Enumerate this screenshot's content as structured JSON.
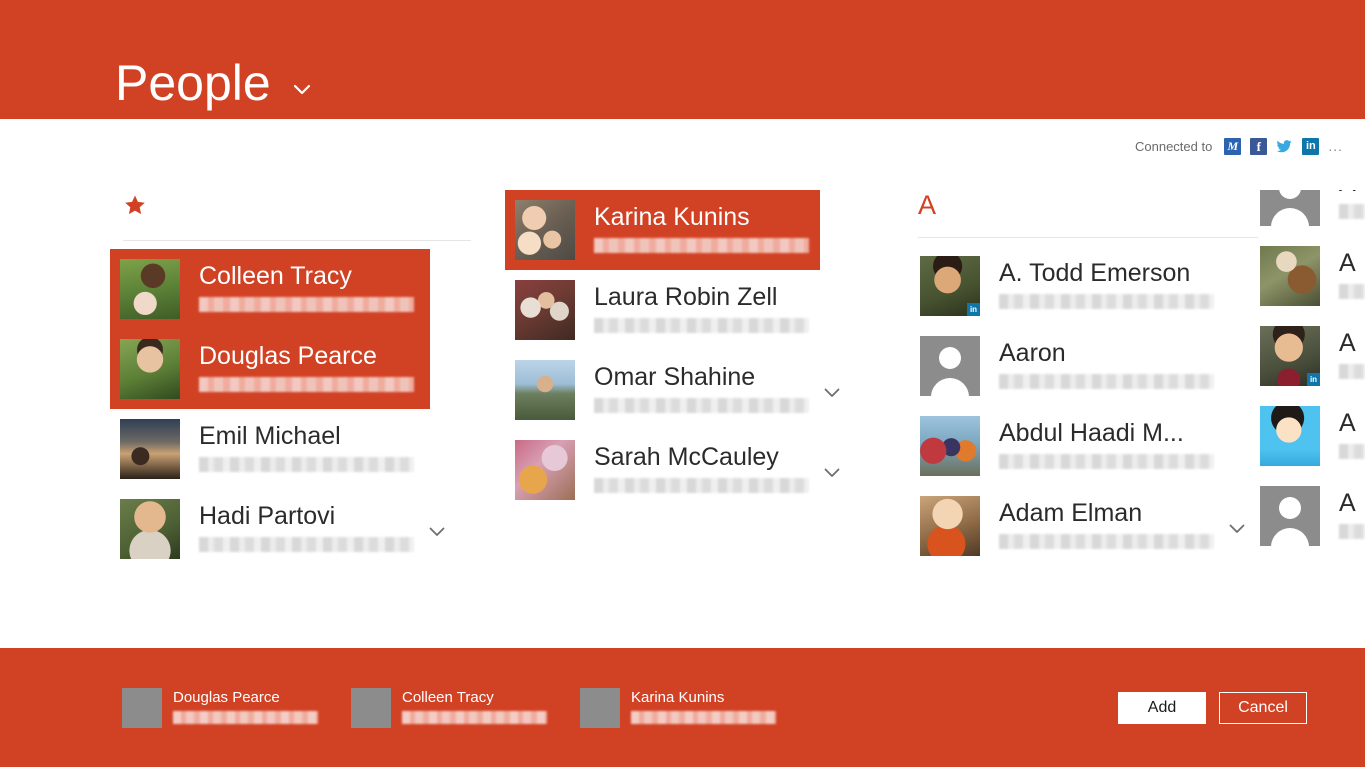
{
  "header": {
    "title": "People",
    "dropdown_icon": "chevron-down-icon"
  },
  "connected": {
    "label": "Connected to",
    "services": [
      {
        "name": "microsoft-icon",
        "glyph": "M"
      },
      {
        "name": "facebook-icon",
        "glyph": "f"
      },
      {
        "name": "twitter-icon",
        "glyph": ""
      },
      {
        "name": "linkedin-icon",
        "glyph": "in"
      }
    ],
    "more": "..."
  },
  "columns": [
    {
      "group_header": "★",
      "group_type": "star",
      "contacts": [
        {
          "name": "Colleen Tracy",
          "selected": true,
          "avatar": "photo",
          "chevron": false,
          "check": true
        },
        {
          "name": "Douglas Pearce",
          "selected": true,
          "avatar": "photo",
          "chevron": true,
          "check": true
        },
        {
          "name": "Emil Michael",
          "selected": false,
          "avatar": "photo",
          "chevron": false,
          "check": false
        },
        {
          "name": "Hadi Partovi",
          "selected": false,
          "avatar": "photo",
          "chevron": true,
          "check": false
        }
      ]
    },
    {
      "group_header": "",
      "group_type": "none",
      "contacts": [
        {
          "name": "Karina Kunins",
          "selected": true,
          "avatar": "photo",
          "chevron": false,
          "check": true
        },
        {
          "name": "Laura Robin Zell",
          "selected": false,
          "avatar": "photo",
          "chevron": false,
          "check": false
        },
        {
          "name": "Omar Shahine",
          "selected": false,
          "avatar": "photo",
          "chevron": true,
          "check": false
        },
        {
          "name": "Sarah McCauley",
          "selected": false,
          "avatar": "photo",
          "chevron": true,
          "check": false
        }
      ]
    },
    {
      "group_header": "A",
      "group_type": "letter",
      "contacts": [
        {
          "name": "A. Todd Emerson",
          "selected": false,
          "avatar": "photo",
          "badge": "linkedin",
          "chevron": false,
          "check": false
        },
        {
          "name": "Aaron",
          "selected": false,
          "avatar": "placeholder",
          "chevron": false,
          "check": false
        },
        {
          "name": "Abdul Haadi M...",
          "selected": false,
          "avatar": "photo",
          "chevron": false,
          "check": false
        },
        {
          "name": "Adam Elman",
          "selected": false,
          "avatar": "photo",
          "chevron": true,
          "check": false
        }
      ]
    },
    {
      "group_header": "",
      "group_type": "none",
      "clipped": true,
      "contacts": [
        {
          "name": "A",
          "selected": false,
          "avatar": "placeholder",
          "chevron": false,
          "check": false
        },
        {
          "name": "A",
          "selected": false,
          "avatar": "photo",
          "chevron": false,
          "check": false
        },
        {
          "name": "A",
          "selected": false,
          "avatar": "photo",
          "badge": "linkedin",
          "chevron": false,
          "check": false
        },
        {
          "name": "A",
          "selected": false,
          "avatar": "photo",
          "chevron": false,
          "check": false
        },
        {
          "name": "A",
          "selected": false,
          "avatar": "placeholder",
          "chevron": false,
          "check": false
        }
      ]
    }
  ],
  "appbar": {
    "chips": [
      {
        "name": "Douglas Pearce"
      },
      {
        "name": "Colleen Tracy"
      },
      {
        "name": "Karina Kunins"
      }
    ],
    "add_label": "Add",
    "cancel_label": "Cancel"
  },
  "colors": {
    "brand_orange": "#d14124",
    "name_text": "#2b2b2b",
    "divider": "#e6e6e6",
    "placeholder_avatar": "#8c8c8c"
  }
}
